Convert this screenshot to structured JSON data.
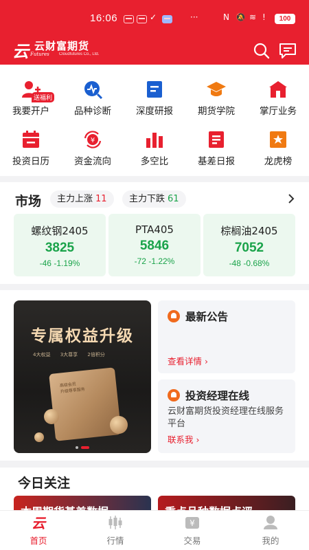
{
  "status_bar": {
    "time": "16:06",
    "battery": "100"
  },
  "header": {
    "brand_name": "云财富期货",
    "brand_sub_italic": "Futures",
    "brand_sub": "Cloudfutures Co., Ltd.",
    "brand_color": "#e8202f",
    "actions": [
      {
        "name": "search-button",
        "icon": "search-icon"
      },
      {
        "name": "message-button",
        "icon": "message-icon"
      }
    ]
  },
  "quick_menu": {
    "badge": "送福利",
    "items": [
      {
        "label": "我要开户",
        "icon": "add-user-icon"
      },
      {
        "label": "品种诊断",
        "icon": "diagnosis-icon"
      },
      {
        "label": "深度研报",
        "icon": "report-icon"
      },
      {
        "label": "期货学院",
        "icon": "graduation-cap-icon"
      },
      {
        "label": "掌厅业务",
        "icon": "hall-icon"
      },
      {
        "label": "投资日历",
        "icon": "calendar-icon"
      },
      {
        "label": "资金流向",
        "icon": "fund-flow-icon"
      },
      {
        "label": "多空比",
        "icon": "bar-chart-icon"
      },
      {
        "label": "基差日报",
        "icon": "daily-report-icon"
      },
      {
        "label": "龙虎榜",
        "icon": "ranking-icon"
      }
    ]
  },
  "market": {
    "title": "市场",
    "up_label": "主力上涨",
    "up_count": "11",
    "down_label": "主力下跌",
    "down_count": "61",
    "cards": [
      {
        "name": "螺纹钢2405",
        "price": "3825",
        "change": "-46  -1.19%"
      },
      {
        "name": "PTA405",
        "price": "5846",
        "change": "-72  -1.22%"
      },
      {
        "name": "棕榈油2405",
        "price": "7052",
        "change": "-48  -0.68%"
      }
    ]
  },
  "promo": {
    "banner_title": "专属权益升级",
    "banner_tags": [
      "4大权益",
      "3大尊享",
      "2倍积分"
    ],
    "banner_card_text": [
      "高级会员",
      "升级尊享服务"
    ],
    "notice": {
      "title": "最新公告",
      "link": "查看详情"
    },
    "manager": {
      "title": "投资经理在线",
      "body": "云财富期货投资经理在线服务平台",
      "link": "联系我"
    }
  },
  "today": {
    "title": "今日关注",
    "cards": [
      "本周期货基差数据",
      "重点品种数据点评"
    ]
  },
  "tab_bar": {
    "tabs": [
      {
        "label": "首页",
        "icon": "home-icon",
        "active": true
      },
      {
        "label": "行情",
        "icon": "candlestick-icon",
        "active": false
      },
      {
        "label": "交易",
        "icon": "trade-icon",
        "active": false
      },
      {
        "label": "我的",
        "icon": "profile-icon",
        "active": false
      }
    ]
  }
}
